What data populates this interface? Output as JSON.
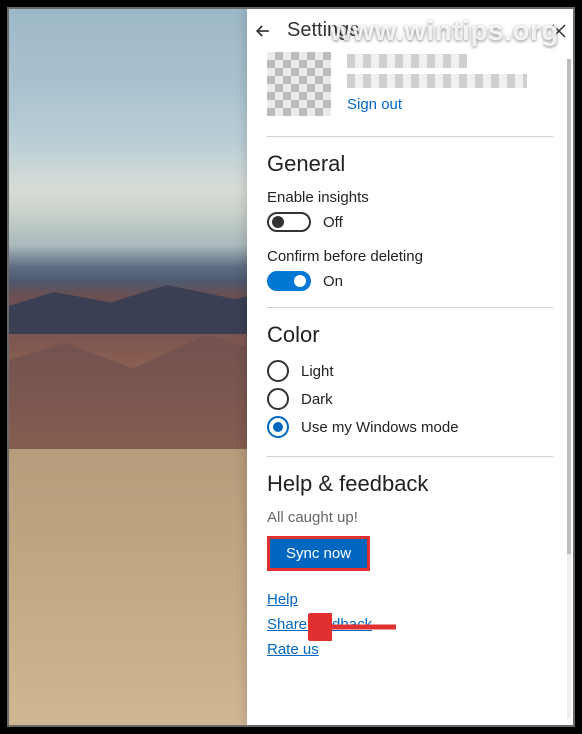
{
  "watermark": "www.wintips.org",
  "header": {
    "title": "Settings"
  },
  "account": {
    "sign_out_label": "Sign out"
  },
  "general": {
    "title": "General",
    "insights_label": "Enable insights",
    "insights_state": "Off",
    "confirm_label": "Confirm before deleting",
    "confirm_state": "On"
  },
  "color": {
    "title": "Color",
    "options": {
      "light": "Light",
      "dark": "Dark",
      "windows": "Use my Windows mode"
    },
    "selected": "windows"
  },
  "help": {
    "title": "Help & feedback",
    "caught_up": "All caught up!",
    "sync_now": "Sync now",
    "help_link": "Help",
    "share_feedback": "Share feedback",
    "rate_us": "Rate us"
  }
}
